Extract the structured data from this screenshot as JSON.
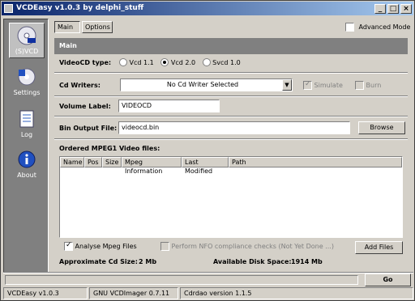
{
  "window": {
    "title": "VCDEasy v1.0.3 by delphi_stuff"
  },
  "sidebar": {
    "items": [
      {
        "label": "(S)VCD"
      },
      {
        "label": "Settings"
      },
      {
        "label": "Log"
      },
      {
        "label": "About"
      }
    ]
  },
  "tabs": [
    {
      "label": "Main"
    },
    {
      "label": "Options"
    }
  ],
  "advanced_mode": {
    "label": "Advanced Mode",
    "checked": false
  },
  "panel": {
    "title": "Main"
  },
  "videocd_type": {
    "label": "VideoCD type:",
    "options": [
      {
        "label": "Vcd 1.1",
        "selected": false
      },
      {
        "label": "Vcd 2.0",
        "selected": true
      },
      {
        "label": "Svcd 1.0",
        "selected": false
      }
    ]
  },
  "cd_writers": {
    "label": "Cd Writers:",
    "value": "No Cd Writer Selected",
    "simulate": {
      "label": "Simulate",
      "checked": true
    },
    "burn": {
      "label": "Burn",
      "checked": false
    }
  },
  "volume_label": {
    "label": "Volume Label:",
    "value": "VIDEOCD"
  },
  "bin_output": {
    "label": "Bin Output File:",
    "value": "videocd.bin",
    "browse": "Browse"
  },
  "video_files": {
    "label": "Ordered MPEG1 Video files:",
    "columns": [
      "Name",
      "Pos",
      "Size",
      "Mpeg Information",
      "Last Modified",
      "Path"
    ]
  },
  "analyse": {
    "label": "Analyse Mpeg Files",
    "checked": true
  },
  "nfo": {
    "label": "Perform NFO compliance checks (Not Yet Done ...)",
    "checked": false
  },
  "add_files": "Add Files",
  "approx_size": {
    "label": "Approximate Cd Size:",
    "value": "2 Mb"
  },
  "disk_space": {
    "label": "Available Disk Space:",
    "value": "1914 Mb"
  },
  "go": "Go",
  "status": [
    "VCDEasy v1.0.3",
    "GNU VCDImager 0.7.11",
    "Cdrdao version 1.1.5"
  ],
  "colors": {
    "title_start": "#0a246a",
    "title_end": "#a6caf0",
    "sidebar": "#808080"
  }
}
